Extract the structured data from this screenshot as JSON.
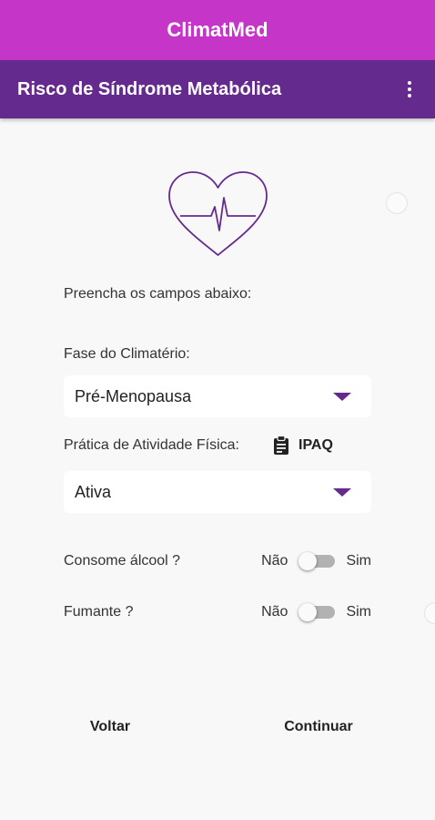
{
  "status_bar": {
    "title": "ClimatMed"
  },
  "app_bar": {
    "title": "Risco de Síndrome Metabólica",
    "menu_icon": "more-vert-icon"
  },
  "form": {
    "instructions": "Preencha os campos abaixo:",
    "phase_label": "Fase do Climatério:",
    "phase_value": "Pré-Menopausa",
    "activity_label": "Prática de Atividade Física:",
    "ipaq_label": "IPAQ",
    "activity_value": "Ativa",
    "alcohol": {
      "question": "Consome álcool ?",
      "off_label": "Não",
      "on_label": "Sim",
      "value": false
    },
    "smoker": {
      "question": "Fumante ?",
      "off_label": "Não",
      "on_label": "Sim",
      "value": false
    }
  },
  "buttons": {
    "back": "Voltar",
    "continue": "Continuar"
  },
  "colors": {
    "status_bar": "#c536c8",
    "app_bar": "#652a8e",
    "accent": "#652a8e",
    "background": "#f8f8f8"
  }
}
